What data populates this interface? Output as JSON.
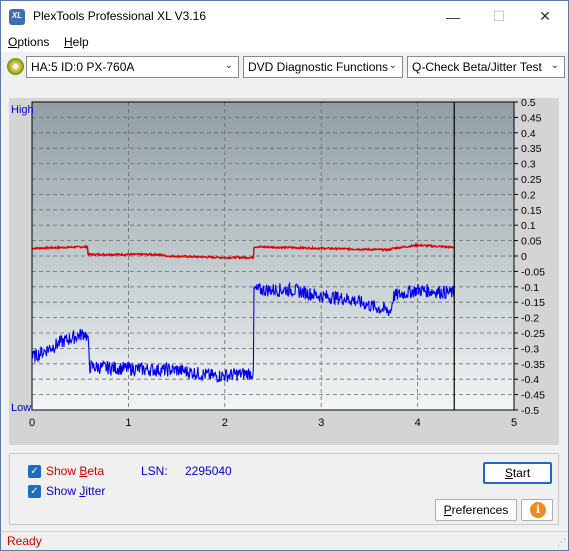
{
  "window": {
    "title": "PlexTools Professional XL V3.16",
    "logo_text": "XL",
    "controls": {
      "minimize": "—",
      "maximize": "☐",
      "close": "✕"
    }
  },
  "menu": {
    "options": {
      "first": "O",
      "rest": "ptions"
    },
    "help": {
      "first": "H",
      "rest": "elp"
    }
  },
  "toolbar": {
    "drive": "HA:5 ID:0  PX-760A",
    "function": "DVD Diagnostic Functions",
    "test": "Q-Check Beta/Jitter Test",
    "arrow": "⌄"
  },
  "chart_data": {
    "type": "line",
    "xlim": [
      0,
      5
    ],
    "x_ticks": [
      "0",
      "1",
      "2",
      "3",
      "4",
      "5"
    ],
    "y_right_lim": [
      -0.5,
      0.5
    ],
    "y_right_ticks": [
      "0.5",
      "0.45",
      "0.4",
      "0.35",
      "0.3",
      "0.25",
      "0.2",
      "0.15",
      "0.1",
      "0.05",
      "0",
      "-0.05",
      "-0.1",
      "-0.15",
      "-0.2",
      "-0.25",
      "-0.3",
      "-0.35",
      "-0.4",
      "-0.45",
      "-0.5"
    ],
    "y_left_labels": {
      "top": "High",
      "bottom": "Low"
    },
    "grid": true,
    "end_marker_x": 4.38,
    "series": [
      {
        "color": "#e00000",
        "x": [
          0,
          0.58,
          0.58,
          1.3,
          1.4,
          2.0,
          2.3,
          2.3,
          3.7,
          3.75,
          4.0,
          4.38
        ],
        "y": [
          0.025,
          0.03,
          0.005,
          0.005,
          0.0,
          -0.005,
          -0.005,
          0.03,
          0.02,
          0.025,
          0.035,
          0.028
        ]
      },
      {
        "color": "#0000ee",
        "x": [
          0,
          0.3,
          0.55,
          0.58,
          0.6,
          1.3,
          1.5,
          1.9,
          2.3,
          2.3,
          2.7,
          3.0,
          3.3,
          3.6,
          3.72,
          3.75,
          4.0,
          4.38
        ],
        "y": [
          -0.33,
          -0.28,
          -0.25,
          -0.27,
          -0.36,
          -0.37,
          -0.37,
          -0.39,
          -0.38,
          -0.11,
          -0.11,
          -0.13,
          -0.14,
          -0.17,
          -0.18,
          -0.13,
          -0.11,
          -0.12
        ]
      }
    ]
  },
  "controls": {
    "show_beta": {
      "prefix": "Show ",
      "first": "B",
      "rest": "eta",
      "checked": true
    },
    "show_jitter": {
      "prefix": "Show ",
      "first": "J",
      "rest": "itter",
      "checked": true
    },
    "lsn_label": "LSN:",
    "lsn_value": "2295040",
    "start": {
      "first": "S",
      "rest": "tart"
    },
    "preferences": {
      "first": "P",
      "rest": "references"
    },
    "info_icon_char": "i"
  },
  "status": {
    "text": "Ready",
    "grip": "⋰"
  }
}
